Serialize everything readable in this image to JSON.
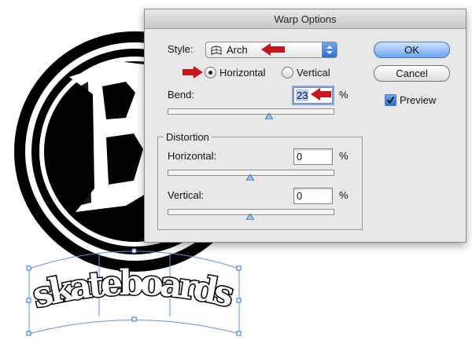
{
  "artwork": {
    "logo_text": "skateboards"
  },
  "dialog": {
    "title": "Warp Options",
    "style_label": "Style:",
    "style_value": "Arch",
    "orientation": {
      "horizontal_label": "Horizontal",
      "vertical_label": "Vertical",
      "selected": "Horizontal"
    },
    "bend": {
      "label": "Bend:",
      "value": "23",
      "unit": "%",
      "slider_fraction": 0.615
    },
    "distortion": {
      "group_label": "Distortion",
      "horizontal": {
        "label": "Horizontal:",
        "value": "0",
        "unit": "%",
        "slider_fraction": 0.5
      },
      "vertical": {
        "label": "Vertical:",
        "value": "0",
        "unit": "%",
        "slider_fraction": 0.5
      }
    },
    "buttons": {
      "ok": "OK",
      "cancel": "Cancel"
    },
    "preview": {
      "label": "Preview",
      "checked": true
    }
  },
  "colors": {
    "annotation_arrow": "#c4161c",
    "accent_blue": "#2f6fd1",
    "dialog_bg": "#e8e8e8"
  }
}
